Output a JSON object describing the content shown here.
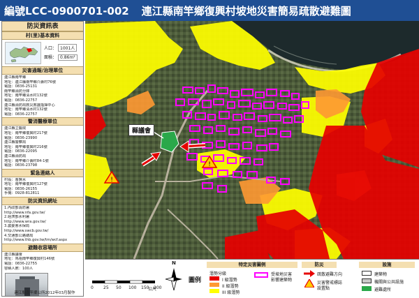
{
  "title": {
    "code": "編號LCC-0900701-002",
    "name": "連江縣南竿鄉復興村坡地災害簡易疏散避難圖"
  },
  "panel": {
    "main_title": "防災資訊表",
    "basic": {
      "heading": "村(里)基本資料",
      "population_label": "人口：",
      "population_value": "1001人",
      "area_label": "面積：",
      "area_value": "0.86m²"
    },
    "units": {
      "heading": "災害通報/治理單位",
      "lines": [
        "連江縣南竿鄉",
        "地址：連江縣南竿鄉介壽村76號",
        "電話：0836-25131",
        "南竿鄉消防分隊",
        "地址：南竿鄉清水村132號",
        "電話：0836-22757",
        "連江縣消防局救災救護指揮中心",
        "地址：南竿鄉清水村132號",
        "電話：0836-22757"
      ]
    },
    "police": {
      "heading": "警消醫療單位",
      "lines": [
        "連江縣立醫院",
        "地址：南竿鄉復興村217號",
        "電話：0836-23990",
        "連江縣警察局",
        "地址：南竿鄉復興村216號",
        "電話：0836-22095",
        "連江縣消防局",
        "地址：南竿鄉介壽村84-1號",
        "電話：0836-23798"
      ]
    },
    "contact": {
      "heading": "緊急連絡人",
      "lines": [
        "村長：曹賢水",
        "地址：南竿鄉復興村127號",
        "電話：0836-26155",
        "手機：0928-812811"
      ]
    },
    "info": {
      "heading": "防災資訊網址",
      "lines": [
        "1.內政部消防署",
        "  http://www.nfa.gov.tw/",
        "2.經濟部水利署",
        "  http://www.wra.gov.tw/",
        "3.農委會水保局",
        "  http://www.swcb.gov.tw/",
        "4.交通部公路總局",
        "  http://www.thb.gov.tw/tm/wcf.aspx"
      ]
    },
    "shelter": {
      "heading": "避難收容場所",
      "lines": [
        "連江縣議會",
        "地址：馬祖南竿鄉復興村146號",
        "電話：0836-22755",
        "容納人數：100人"
      ]
    },
    "credit": "連江縣南竿鄉公所2012年03月製作"
  },
  "map": {
    "council_label": "縣議會",
    "scale_ticks": [
      "0",
      "25",
      "50",
      "100",
      "150",
      "200"
    ],
    "scale_unit": "公尺",
    "north_label": "N"
  },
  "legend": {
    "region_label": "圖例",
    "hazard": {
      "heading": "特定災害圖例",
      "column_head": "潛勢分級",
      "level1": "I 級潛勢",
      "level2": "II 級潛勢",
      "level3": "III 級潛勢",
      "affected_line1": "受坡地災害",
      "affected_line2": "影響建築物"
    },
    "prevention": {
      "heading": "防災",
      "route": "疏散避難方向",
      "warning_line1": "災害警戒標誌",
      "warning_line2": "設置點"
    },
    "facility": {
      "heading": "設施",
      "building": "建築物",
      "public": "機關與公共設施",
      "shelter": "避難處所"
    },
    "colors": {
      "level1": "#e60000",
      "level2": "#ff9933",
      "level3": "#ffff00",
      "affected": "#ff00ff",
      "shelter": "#2aa84a",
      "route": "#e60000"
    }
  }
}
